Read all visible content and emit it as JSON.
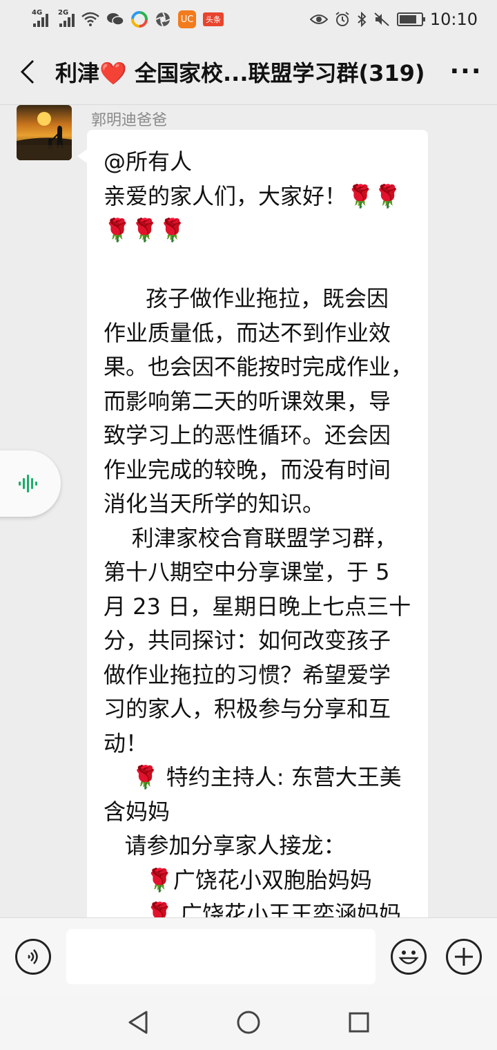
{
  "status_bar": {
    "left": {
      "sim1": "4G",
      "sim2": "2G",
      "toutiao_badge": "头条"
    },
    "right_icons": [
      "eye-icon",
      "alarm-icon",
      "bluetooth-icon",
      "mute-icon",
      "battery-icon"
    ],
    "battery_level": 0.7,
    "time": "10:10"
  },
  "header": {
    "title_prefix": "利津",
    "title_emoji": "❤️",
    "title_suffix": "全国家校...联盟学习群(319)",
    "back_icon": "chevron-left-icon",
    "more_icon": "more-icon",
    "more_label": "···"
  },
  "message": {
    "sender": "郭明迪爸爸",
    "lines": [
      "@所有人",
      "亲爱的家人们，大家好！🌹🌹",
      "🌹🌹🌹",
      "",
      "      孩子做作业拖拉，既会因",
      "作业质量低，而达不到作业效",
      "果。也会因不能按时完成作业，",
      "而影响第二天的听课效果，导",
      "致学习上的恶性循环。还会因",
      "作业完成的较晚，而没有时间",
      "消化当天所学的知识。",
      "    利津家校合育联盟学习群，",
      "第十八期空中分享课堂，于 5",
      "月 23 日，星期日晚上七点三十",
      "分，共同探讨：如何改变孩子",
      "做作业拖拉的习惯？希望爱学",
      "习的家人，积极参与分享和互",
      "动！",
      "    🌹 特约主持人: 东营大王美",
      "含妈妈",
      "   请参加分享家人接龙：",
      "      🌹广饶花小双胞胎妈妈",
      "      🌹 广饶花小王王奕涵妈妈"
    ]
  },
  "floating_voice": {
    "icon": "voice-wave-icon"
  },
  "input_bar": {
    "voice_icon": "voice-input-icon",
    "input_value": "",
    "emoji_icon": "emoji-icon",
    "plus_icon": "plus-icon"
  },
  "nav_bar": {
    "back": "nav-back-icon",
    "home": "nav-home-icon",
    "recent": "nav-recent-icon"
  }
}
